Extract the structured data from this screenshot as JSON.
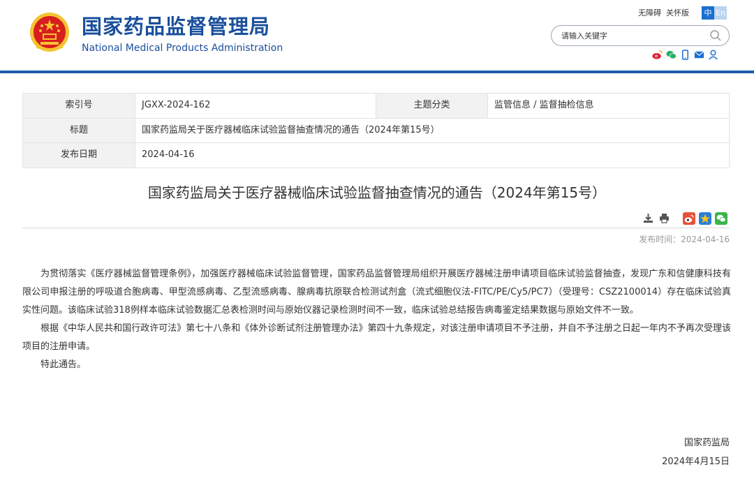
{
  "header": {
    "title_cn": "国家药品监督管理局",
    "title_en": "National Medical Products Administration",
    "links": [
      "无障碍",
      "关怀版"
    ],
    "lang_zh": "中",
    "lang_en": "En",
    "search_placeholder": "请输入关键字",
    "share_icons": [
      "weibo-icon",
      "wechat-icon",
      "mobile-icon",
      "mail-icon",
      "user-icon"
    ],
    "colors": {
      "brand": "#1a4f9c",
      "bar": "#1d5da8",
      "lang_active": "#1a6fd0"
    }
  },
  "info": {
    "index_label": "索引号",
    "index_value": "JGXX-2024-162",
    "category_label": "主题分类",
    "category_value": "监管信息 / 监督抽检信息",
    "title_label": "标题",
    "title_value": "国家药监局关于医疗器械临床试验监督抽查情况的通告（2024年第15号）",
    "date_label": "发布日期",
    "date_value": "2024-04-16"
  },
  "article": {
    "title": "国家药监局关于医疗器械临床试验监督抽查情况的通告（2024年第15号）",
    "tool_icons": [
      "download-icon",
      "print-icon",
      "weibo-share-icon",
      "qzone-share-icon",
      "wechat-share-icon"
    ],
    "pub_time": "发布时间：2024-04-16",
    "paragraphs": [
      "为贯彻落实《医疗器械监督管理条例》，加强医疗器械临床试验监督管理，国家药品监督管理局组织开展医疗器械注册申请项目临床试验监督抽查，发现广东和信健康科技有限公司申报注册的呼吸道合胞病毒、甲型流感病毒、乙型流感病毒、腺病毒抗原联合检测试剂盒（流式细胞仪法-FITC/PE/Cy5/PC7）（受理号：CSZ2100014）存在临床试验真实性问题。该临床试验318例样本临床试验数据汇总表检测时间与原始仪器记录检测时间不一致，临床试验总结报告病毒鉴定结果数据与原始文件不一致。",
      "根据《中华人民共和国行政许可法》第七十八条和《体外诊断试剂注册管理办法》第四十九条规定，对该注册申请项目不予注册，并自不予注册之日起一年内不予再次受理该项目的注册申请。",
      "特此通告。"
    ],
    "signature": "国家药监局",
    "sign_date": "2024年4月15日"
  }
}
